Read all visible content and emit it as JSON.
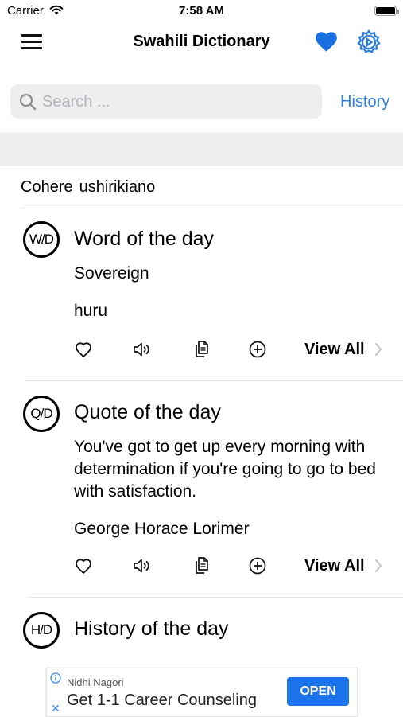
{
  "status_bar": {
    "carrier": "Carrier",
    "time": "7:58 AM"
  },
  "nav": {
    "title": "Swahili Dictionary"
  },
  "search": {
    "placeholder": "Search ...",
    "value": "",
    "history_label": "History"
  },
  "last_lookup": {
    "english": "Cohere",
    "swahili": "ushirikiano"
  },
  "word_of_day": {
    "badge": "W/D",
    "title": "Word of the day",
    "word": "Sovereign",
    "translation": "huru",
    "view_all": "View All"
  },
  "quote_of_day": {
    "badge": "Q/D",
    "title": "Quote of the day",
    "quote": "You've got to get up every morning with determination if you're going to go to bed with satisfaction.",
    "author": "George Horace Lorimer",
    "view_all": "View All"
  },
  "history_of_day": {
    "badge": "H/D",
    "title": "History of the day"
  },
  "ad": {
    "advertiser": "Nidhi Nagori",
    "title": "Get 1-1 Career Counseling",
    "cta": "OPEN"
  },
  "colors": {
    "accent": "#2b7de1",
    "heart": "#1a6fe0",
    "ad_button": "#1a73e8"
  }
}
